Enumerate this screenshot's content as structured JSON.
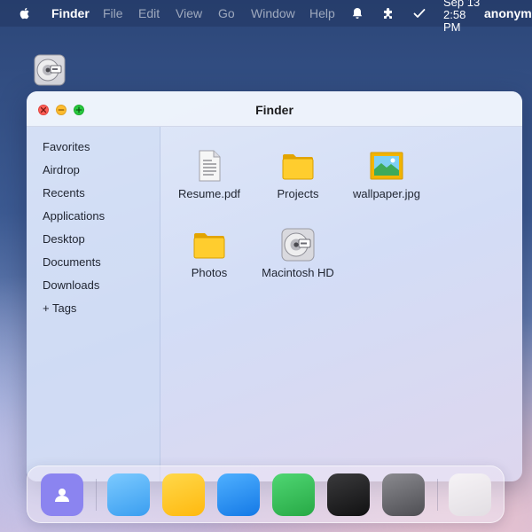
{
  "menubar": {
    "apple_icon": "apple-logo-icon",
    "app_name": "Finder",
    "menus": [
      "File",
      "Edit",
      "View",
      "Go",
      "Window",
      "Help"
    ],
    "tray_icons": [
      "bell-icon",
      "puzzle-icon",
      "checkmark-icon"
    ],
    "clock": {
      "date": "Sep 13",
      "time": "2:58 PM"
    },
    "user": "anonymous"
  },
  "desktop": {
    "icons": [
      {
        "icon": "hard-drive-icon"
      }
    ]
  },
  "window": {
    "title": "Finder",
    "controls": [
      "close",
      "minimize",
      "zoom"
    ],
    "sidebar": {
      "items": [
        {
          "label": "Favorites"
        },
        {
          "label": "Airdrop"
        },
        {
          "label": "Recents"
        },
        {
          "label": "Applications"
        },
        {
          "label": "Desktop"
        },
        {
          "label": "Documents"
        },
        {
          "label": "Downloads"
        },
        {
          "label": "+ Tags"
        }
      ]
    },
    "files": [
      {
        "name": "Resume.pdf",
        "icon": "document-icon"
      },
      {
        "name": "Projects",
        "icon": "folder-icon"
      },
      {
        "name": "wallpaper.jpg",
        "icon": "image-icon"
      },
      {
        "name": "Photos",
        "icon": "folder-icon"
      },
      {
        "name": "Macintosh HD",
        "icon": "hard-drive-icon"
      }
    ]
  },
  "dock": {
    "apps": [
      {
        "icon": "contacts-icon",
        "color": "#8b84f0"
      },
      {
        "icon": "app-icon-light-blue",
        "color": "#5ab4f5"
      },
      {
        "icon": "app-icon-yellow",
        "color": "#ffc52a"
      },
      {
        "icon": "app-icon-blue",
        "color": "#2e94f2"
      },
      {
        "icon": "app-icon-green",
        "color": "#3cc65c"
      },
      {
        "icon": "app-icon-black",
        "color": "#2b2b2b"
      },
      {
        "icon": "app-icon-gray",
        "color": "#6e6e73"
      },
      {
        "icon": "trash-icon",
        "color": "#ece9ee"
      }
    ]
  }
}
